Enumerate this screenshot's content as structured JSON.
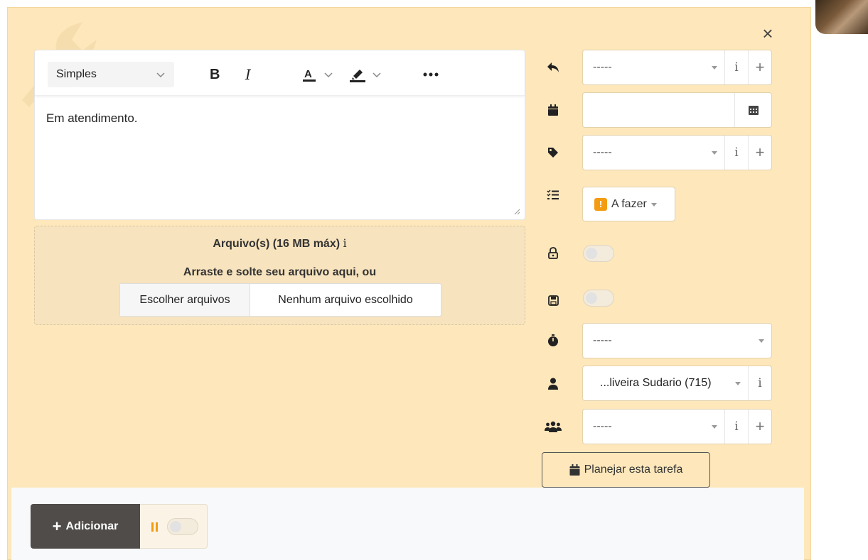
{
  "editor": {
    "style_select": "Simples",
    "content": "Em atendimento."
  },
  "attachments": {
    "title": "Arquivo(s) (16 MB máx)",
    "info_icon": "i",
    "drop_text": "Arraste e solte seu arquivo aqui, ou",
    "choose_button": "Escolher arquivos",
    "no_file_text": "Nenhum arquivo escolhido"
  },
  "fields": {
    "reply_select": "-----",
    "date_input": "",
    "tag_select": "-----",
    "status": "A fazer",
    "timer_select": "-----",
    "user_select": "...liveira Sudario (715)",
    "group_select": "-----",
    "info_label": "i",
    "plus_label": "+"
  },
  "plan_button": "Planejar esta tarefa",
  "footer": {
    "add_button": "Adicionar",
    "add_plus": "+"
  },
  "colors": {
    "modal_bg": "#fde7bb",
    "status_badge": "#f39c12",
    "add_button_bg": "#4f4c49"
  }
}
